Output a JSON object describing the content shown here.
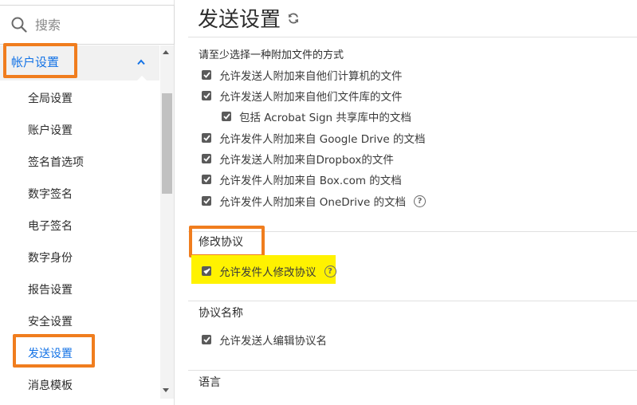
{
  "sidebar": {
    "search_placeholder": "搜索",
    "parent": "帐户设置",
    "items": [
      {
        "label": "全局设置"
      },
      {
        "label": "账户设置"
      },
      {
        "label": "签名首选项"
      },
      {
        "label": "数字签名"
      },
      {
        "label": "电子签名"
      },
      {
        "label": "数字身份"
      },
      {
        "label": "报告设置"
      },
      {
        "label": "安全设置"
      },
      {
        "label": "发送设置",
        "active": true
      },
      {
        "label": "消息模板"
      }
    ]
  },
  "main": {
    "title": "发送设置",
    "attach": {
      "heading": "请至少选择一种附加文件的方式",
      "options": [
        {
          "label": "允许发送人附加来自他们计算机的文件",
          "checked": true
        },
        {
          "label": "允许发送人附加来自他们文件库的文件",
          "checked": true
        },
        {
          "label": "包括 Acrobat Sign 共享库中的文档",
          "checked": true
        },
        {
          "label": "允许发件人附加来自 Google Drive 的文档",
          "checked": true
        },
        {
          "label": "允许发送人附加来自Dropbox的文件",
          "checked": true
        },
        {
          "label": "允许发件人附加来自 Box.com 的文档",
          "checked": true
        },
        {
          "label": "允许发件人附加来自 OneDrive 的文档",
          "checked": true
        }
      ]
    },
    "modify": {
      "heading": "修改协议",
      "option": "允许发件人修改协议"
    },
    "name": {
      "heading": "协议名称",
      "option": "允许发送人编辑协议名"
    },
    "language": {
      "heading": "语言"
    },
    "help_glyph": "?",
    "colors": {
      "accent": "#1473e6",
      "highlight_box": "#f07d1e",
      "highlight_fill": "#fff200"
    }
  }
}
